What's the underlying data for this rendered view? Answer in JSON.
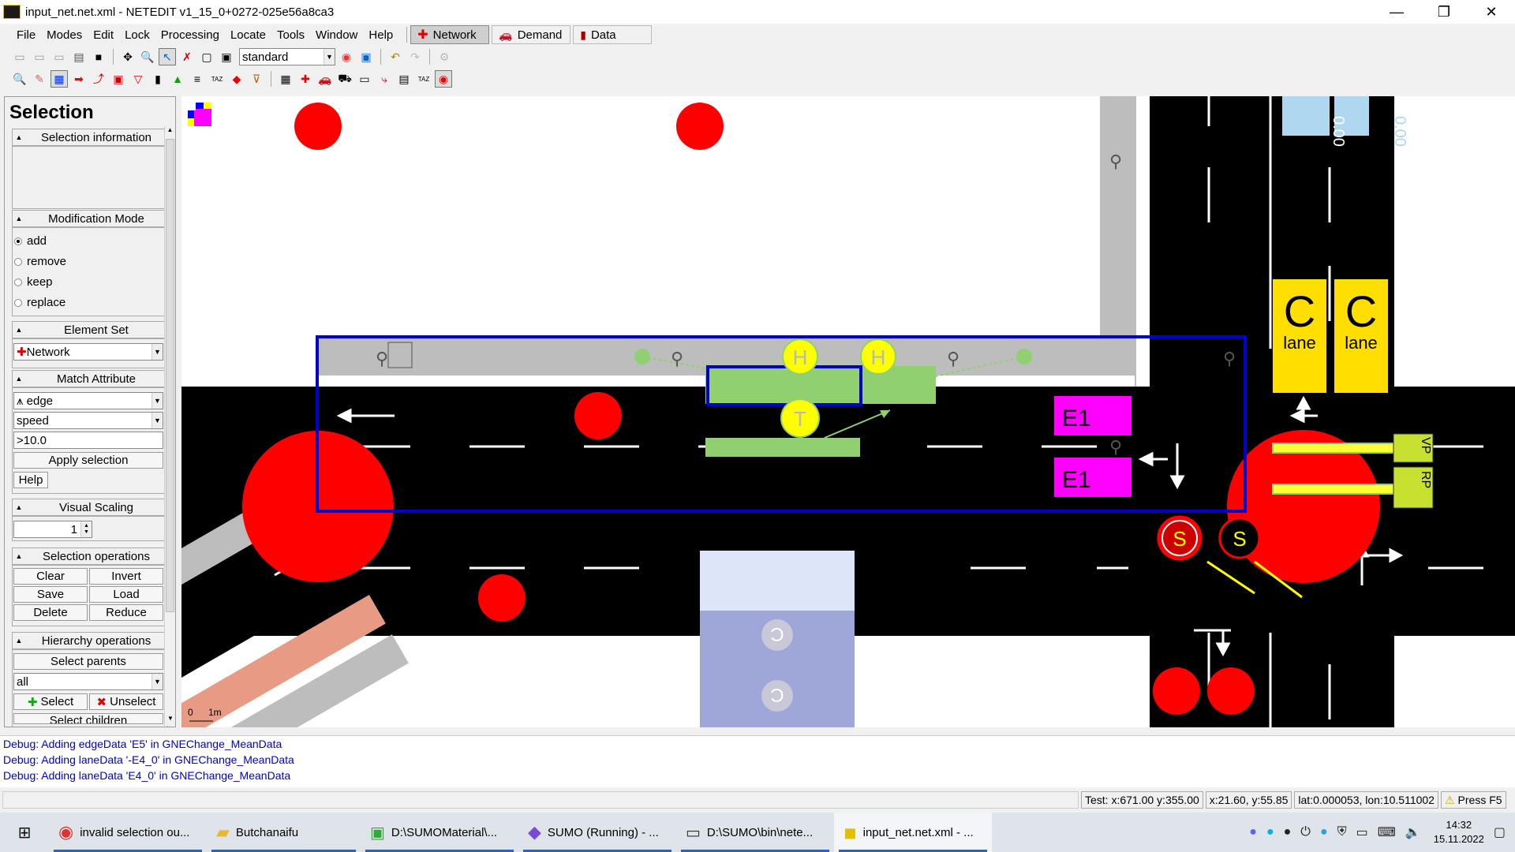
{
  "window": {
    "title": "input_net.net.xml - NETEDIT v1_15_0+0272-025e56a8ca3",
    "minimize": "—",
    "maximize": "❐",
    "close": "✕"
  },
  "menu": [
    "File",
    "Modes",
    "Edit",
    "Lock",
    "Processing",
    "Locate",
    "Tools",
    "Window",
    "Help"
  ],
  "supermodes": [
    {
      "label": "Network",
      "active": true
    },
    {
      "label": "Demand",
      "active": false
    },
    {
      "label": "Data",
      "active": false
    }
  ],
  "toolbar": {
    "view_scheme": "standard"
  },
  "panel": {
    "title": "Selection",
    "selection_information": "Selection information",
    "modification_mode": "Modification Mode",
    "modes": [
      "add",
      "remove",
      "keep",
      "replace"
    ],
    "selected_mode": "add",
    "element_set": "Element Set",
    "element_set_value": "Network",
    "match_attribute": "Match Attribute",
    "match_type": "edge",
    "match_attr": "speed",
    "match_value": ">10.0",
    "apply_selection": "Apply selection",
    "help": "Help",
    "visual_scaling": "Visual Scaling",
    "visual_scaling_value": "1",
    "selection_operations": "Selection operations",
    "clear": "Clear",
    "invert": "Invert",
    "save": "Save",
    "load": "Load",
    "delete": "Delete",
    "reduce": "Reduce",
    "hierarchy_operations": "Hierarchy operations",
    "select_parents": "Select parents",
    "hierarchy_filter": "all",
    "select": "Select",
    "unselect": "Unselect",
    "select_children": "Select children"
  },
  "canvas": {
    "e1_label": "E1",
    "h_label": "H",
    "t_label": "T",
    "s_label": "S",
    "c_label": "C",
    "lane_label": "lane",
    "vp_label": "VP",
    "rp_label": "RP",
    "vertical_text": "0.00",
    "scale_zero": "0",
    "scale_unit": "1m",
    "colors": {
      "road": "#000000",
      "sidewalk": "#bdbdbd",
      "selection": "#0000cc",
      "stop": "#90d070",
      "detector": "#ff00ff",
      "junction": "#ff0000",
      "charging": "#ffde00",
      "parking": "#b7c0e8"
    }
  },
  "log": [
    "Debug: Adding edgeData 'E5' in GNEChange_MeanData",
    "Debug: Adding laneData '-E4_0' in GNEChange_MeanData",
    "Debug: Adding laneData 'E4_0' in GNEChange_MeanData"
  ],
  "status": {
    "test": "Test: x:671.00 y:355.00",
    "xy": "x:21.60, y:55.85",
    "latlon": "lat:0.000053, lon:10.511002",
    "hint": "Press F5"
  },
  "taskbar": {
    "items": [
      {
        "label": "invalid selection ou...",
        "icon": "chrome-icon"
      },
      {
        "label": "Butchanaifu",
        "icon": "folder-icon"
      },
      {
        "label": "D:\\SUMOMaterial\\...",
        "icon": "app-icon"
      },
      {
        "label": "SUMO (Running) - ...",
        "icon": "visual-studio-icon"
      },
      {
        "label": "D:\\SUMO\\bin\\nete...",
        "icon": "terminal-icon"
      },
      {
        "label": "input_net.net.xml - ...",
        "icon": "netedit-icon",
        "active": true
      }
    ],
    "time": "14:32",
    "date": "15.11.2022"
  }
}
